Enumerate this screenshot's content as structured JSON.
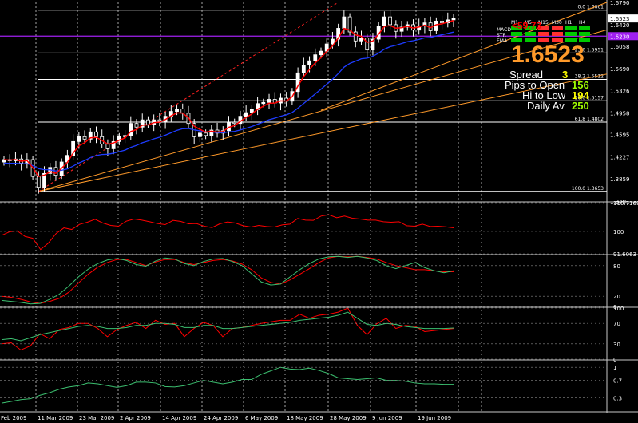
{
  "colors": {
    "background": "#000000",
    "bull_candle": "#ffffff",
    "bear_candle": "#000000",
    "candle_wick": "#ffffff",
    "grid": "#c8c8c8",
    "ema_fast": "#ff0000",
    "ema_slow": "#1e3cff",
    "trendline": "#ff9a2a",
    "fib_line": "#ffffff",
    "purple_line": "#a020f0",
    "dotted_red": "#ff2020",
    "osc_red": "#ff0000",
    "osc_green": "#3cc070",
    "axis_text": "#ffffff",
    "price_big": "#ff9a2a",
    "info_green": "#a0ff00",
    "info_yellow": "#ffff00",
    "red_badge": "#ff0000",
    "bar_green": "#00c800",
    "bar_red": "#ff3030"
  },
  "chart_data": [
    {
      "type": "candlestick",
      "panel": "main",
      "x_labels": [
        "Feb 2009",
        "11 Mar 2009",
        "23 Mar 2009",
        "2 Apr 2009",
        "14 Apr 2009",
        "24 Apr 2009",
        "6 May 2009",
        "18 May 2009",
        "28 May 2009",
        "9 Jun 2009",
        "19 Jun 2009"
      ],
      "y_ticks": [
        1.679,
        1.6523,
        1.642,
        1.6058,
        1.569,
        1.5326,
        1.4958,
        1.4595,
        1.4227,
        1.3859,
        1.3491
      ],
      "ylim": [
        1.3491,
        1.679
      ],
      "current_price": 1.6523,
      "current_price_label": "1.6523",
      "purple_line_value": 1.623,
      "purple_line_label": "1.6230",
      "fib_levels": [
        {
          "label": "0.0 1.6661",
          "value": 1.6661
        },
        {
          "label": "23.6 1.5951",
          "value": 1.5951
        },
        {
          "label": "38.2 1.5512",
          "value": 1.5512
        },
        {
          "label": "50.0 1.5157",
          "value": 1.5157
        },
        {
          "label": "61.8 1.4802",
          "value": 1.4802
        },
        {
          "label": "100.0 1.3653",
          "value": 1.3653
        }
      ],
      "closes": [
        1.418,
        1.416,
        1.419,
        1.412,
        1.418,
        1.39,
        1.372,
        1.395,
        1.405,
        1.392,
        1.414,
        1.425,
        1.448,
        1.456,
        1.452,
        1.464,
        1.456,
        1.444,
        1.436,
        1.448,
        1.456,
        1.458,
        1.478,
        1.472,
        1.484,
        1.476,
        1.484,
        1.481,
        1.49,
        1.498,
        1.502,
        1.495,
        1.478,
        1.456,
        1.462,
        1.458,
        1.467,
        1.462,
        1.466,
        1.48,
        1.478,
        1.49,
        1.496,
        1.501,
        1.511,
        1.513,
        1.518,
        1.512,
        1.52,
        1.515,
        1.531,
        1.562,
        1.575,
        1.582,
        1.592,
        1.598,
        1.61,
        1.618,
        1.636,
        1.655,
        1.63,
        1.615,
        1.62,
        1.6,
        1.618,
        1.64,
        1.655,
        1.642,
        1.631,
        1.638,
        1.642,
        1.633,
        1.64,
        1.645,
        1.632,
        1.648,
        1.645,
        1.65,
        1.652
      ],
      "ema_fast_label": "EMA",
      "ema_slow_label": "EMA"
    },
    {
      "type": "line",
      "panel": "oscillator-1",
      "y_ticks": [
        "110.7169",
        "100",
        "91.6063"
      ],
      "ylim": [
        91.6063,
        110.7169
      ],
      "series": [
        {
          "color": "#ff0000",
          "values": [
            98.5,
            99.8,
            100.2,
            98.1,
            97.4,
            93.2,
            95.6,
            99.2,
            101.3,
            100.7,
            102.6,
            103.4,
            104.5,
            103.1,
            102.2,
            101.9,
            103.8,
            104.6,
            104.2,
            103.6,
            102.9,
            102.5,
            104.1,
            103.7,
            102.8,
            102.9,
            101.9,
            101.4,
            102.8,
            103.5,
            103.1,
            102.1,
            101.6,
            102.2,
            101.8,
            101.6,
            102.4,
            102.7,
            104.8,
            104.2,
            104.1,
            105.7,
            106.2,
            105.1,
            105.7,
            104.9,
            104.6,
            104.2,
            104.2,
            103.6,
            103.4,
            103.6,
            102.1,
            101.9,
            102.7,
            101.8,
            101.9,
            101.7,
            101.3
          ]
        }
      ]
    },
    {
      "type": "line",
      "panel": "oscillator-2",
      "y_ticks": [
        "80",
        "20",
        "0"
      ],
      "ylim": [
        0,
        100
      ],
      "series": [
        {
          "color": "#ff0000",
          "values": [
            20,
            18,
            14,
            9,
            6,
            10,
            16,
            28,
            46,
            63,
            77,
            86,
            92,
            92,
            86,
            80,
            87,
            92,
            92,
            86,
            82,
            86,
            90,
            92,
            89,
            83,
            72,
            56,
            47,
            44,
            52,
            63,
            74,
            86,
            95,
            98,
            97,
            98,
            96,
            93,
            86,
            80,
            76,
            72,
            72,
            70,
            68,
            68
          ]
        },
        {
          "color": "#3cc070",
          "values": [
            12,
            10,
            8,
            5,
            6,
            14,
            24,
            40,
            58,
            73,
            84,
            91,
            94,
            90,
            82,
            79,
            89,
            95,
            93,
            84,
            80,
            88,
            93,
            94,
            88,
            80,
            64,
            48,
            42,
            44,
            58,
            72,
            84,
            93,
            97,
            98,
            96,
            98,
            95,
            90,
            80,
            74,
            80,
            86,
            76,
            70,
            66,
            70
          ]
        }
      ]
    },
    {
      "type": "line",
      "panel": "oscillator-3",
      "y_ticks": [
        "100",
        "70",
        "30",
        "0"
      ],
      "ylim": [
        0,
        100
      ],
      "series": [
        {
          "color": "#ff0000",
          "values": [
            30,
            32,
            18,
            26,
            50,
            40,
            58,
            62,
            70,
            70,
            60,
            44,
            58,
            66,
            72,
            60,
            76,
            68,
            70,
            44,
            60,
            72,
            66,
            44,
            60,
            62,
            66,
            70,
            73,
            76,
            76,
            88,
            80,
            86,
            88,
            92,
            100,
            66,
            48,
            69,
            80,
            60,
            66,
            64,
            54,
            56,
            58,
            60
          ]
        },
        {
          "color": "#3cc070",
          "values": [
            38,
            40,
            36,
            42,
            48,
            52,
            56,
            60,
            64,
            66,
            64,
            60,
            60,
            62,
            66,
            66,
            70,
            70,
            68,
            62,
            62,
            66,
            66,
            60,
            60,
            62,
            64,
            66,
            68,
            70,
            72,
            76,
            78,
            80,
            82,
            86,
            92,
            80,
            68,
            66,
            70,
            68,
            64,
            62,
            60,
            60,
            60,
            61
          ]
        }
      ]
    },
    {
      "type": "line",
      "panel": "oscillator-4",
      "y_ticks": [
        "1",
        "0.7",
        "0.3"
      ],
      "ylim": [
        0,
        1.15
      ],
      "series": [
        {
          "color": "#3cc070",
          "values": [
            0.18,
            0.22,
            0.26,
            0.28,
            0.36,
            0.42,
            0.5,
            0.55,
            0.58,
            0.64,
            0.62,
            0.58,
            0.54,
            0.58,
            0.66,
            0.66,
            0.64,
            0.56,
            0.55,
            0.58,
            0.64,
            0.7,
            0.66,
            0.62,
            0.66,
            0.72,
            0.72,
            0.84,
            0.92,
            1.0,
            0.96,
            0.95,
            0.98,
            0.93,
            0.86,
            0.76,
            0.74,
            0.72,
            0.74,
            0.76,
            0.7,
            0.7,
            0.68,
            0.64,
            0.62,
            0.62,
            0.61,
            0.61
          ]
        }
      ]
    }
  ],
  "info_panel": {
    "pips_badge": "<59.73",
    "timeframes": [
      "M1",
      "M5",
      "M15",
      "M30",
      "H1",
      "H4"
    ],
    "row_labels": [
      "MACD",
      "STR",
      "EMA"
    ],
    "indicator_colors": [
      [
        "green",
        "green",
        "red",
        "red",
        "green",
        "green"
      ],
      [
        "green",
        "green",
        "red",
        "red",
        "green",
        "green"
      ],
      [
        "green",
        "green",
        "red",
        "red",
        "green",
        "green"
      ]
    ],
    "big_price": "1.6523",
    "spread_label": "Spread",
    "spread_value": "3",
    "pips_to_open_label": "Pips to Open",
    "pips_to_open_value": "156",
    "hi_to_low_label": "Hi to Low",
    "hi_to_low_value": "194",
    "daily_av_label": "Daily Av",
    "daily_av_value": "250"
  }
}
